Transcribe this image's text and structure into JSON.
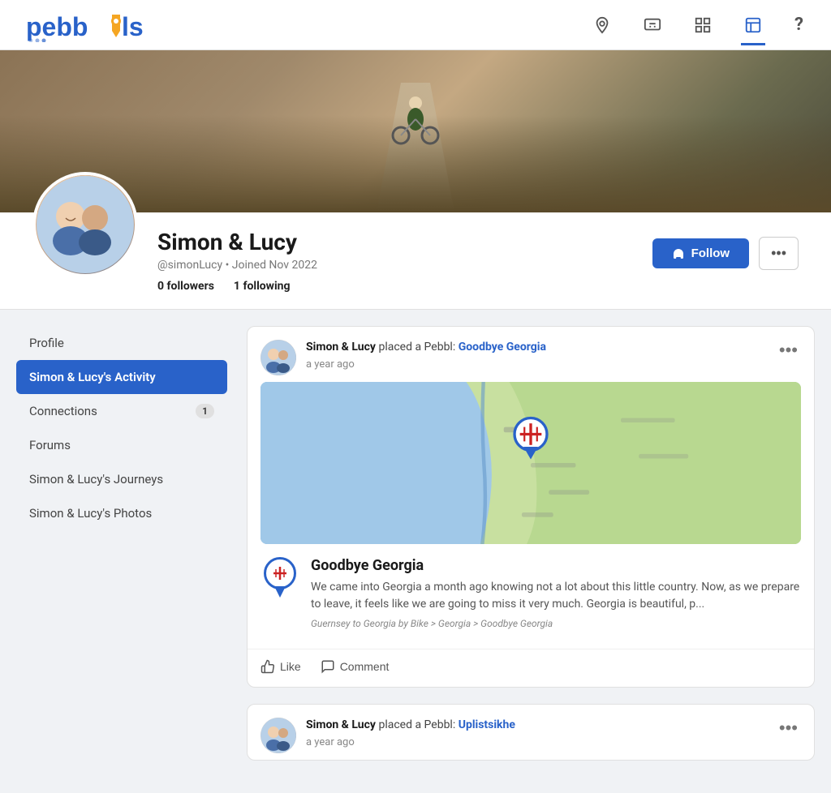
{
  "app": {
    "name": "pebbls",
    "logo_text_before": "pebb",
    "logo_text_after": "s"
  },
  "nav": {
    "icons": [
      {
        "name": "location-icon",
        "symbol": "⊙",
        "label": "Location"
      },
      {
        "name": "message-icon",
        "symbol": "💬",
        "label": "Messages"
      },
      {
        "name": "grid-icon",
        "symbol": "⊞",
        "label": "Grid"
      },
      {
        "name": "profile-icon",
        "symbol": "👤",
        "label": "Profile",
        "active": true
      },
      {
        "name": "help-icon",
        "symbol": "?",
        "label": "Help"
      }
    ]
  },
  "profile": {
    "name": "Simon & Lucy",
    "username": "@simonLucy",
    "joined": "Joined Nov 2022",
    "followers_count": "0",
    "followers_label": "followers",
    "following_count": "1",
    "following_label": "following",
    "follow_button": "Follow",
    "more_button": "•••"
  },
  "sidebar": {
    "items": [
      {
        "id": "profile",
        "label": "Profile",
        "active": false,
        "badge": null
      },
      {
        "id": "activity",
        "label": "Simon & Lucy's Activity",
        "active": true,
        "badge": null
      },
      {
        "id": "connections",
        "label": "Connections",
        "active": false,
        "badge": "1"
      },
      {
        "id": "forums",
        "label": "Forums",
        "active": false,
        "badge": null
      },
      {
        "id": "journeys",
        "label": "Simon & Lucy's Journeys",
        "active": false,
        "badge": null
      },
      {
        "id": "photos",
        "label": "Simon & Lucy's Photos",
        "active": false,
        "badge": null
      }
    ]
  },
  "activity": {
    "cards": [
      {
        "id": "card1",
        "user": "Simon & Lucy",
        "action": "placed a Pebbl:",
        "pebbl_name": "Goodbye Georgia",
        "time": "a year ago",
        "map_alt": "Map showing Georgia coastline",
        "pebbl_title": "Goodbye Georgia",
        "pebbl_description": "We came into Georgia a month ago knowing not a lot about this little country. Now, as we prepare to leave, it feels like we are going to miss it very much. Georgia is beautiful, p...",
        "breadcrumb": "Guernsey to Georgia by Bike > Georgia > Goodbye Georgia",
        "like_label": "Like",
        "comment_label": "Comment"
      },
      {
        "id": "card2",
        "user": "Simon & Lucy",
        "action": "placed a Pebbl:",
        "pebbl_name": "Uplistsikhe",
        "time": "a year ago"
      }
    ]
  }
}
